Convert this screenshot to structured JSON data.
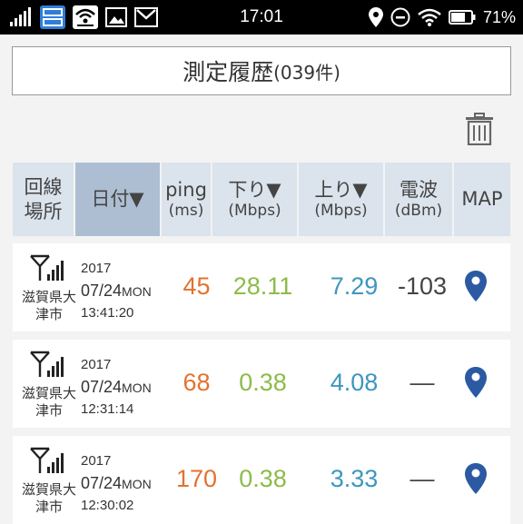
{
  "status_bar": {
    "time": "17:01",
    "battery": "71%",
    "left_icons": [
      "signal-icon",
      "app-icon",
      "wifi-icon",
      "image-icon",
      "gmail-icon"
    ],
    "right_icons": [
      "location-icon",
      "dnd-icon",
      "wifi-icon",
      "battery-icon"
    ]
  },
  "title": {
    "main": "測定履歴",
    "count": "(039件)"
  },
  "table": {
    "headers": [
      {
        "line1": "回線",
        "line2": "場所"
      },
      {
        "line1": "日付▼",
        "line2": ""
      },
      {
        "line1": "ping",
        "line2": "(ms)"
      },
      {
        "line1": "下り▼",
        "line2": "(Mbps)"
      },
      {
        "line1": "上り▼",
        "line2": "(Mbps)"
      },
      {
        "line1": "電波",
        "line2": "(dBm)"
      },
      {
        "line1": "MAP",
        "line2": ""
      }
    ],
    "rows": [
      {
        "area1": "滋賀県大",
        "area2": "津市",
        "year": "2017",
        "date": "07/24",
        "dow": "MON",
        "time": "13:41:20",
        "ping": "45",
        "down": "28.11",
        "up": "7.29",
        "signal": "-103"
      },
      {
        "area1": "滋賀県大",
        "area2": "津市",
        "year": "2017",
        "date": "07/24",
        "dow": "MON",
        "time": "12:31:14",
        "ping": "68",
        "down": "0.38",
        "up": "4.08",
        "signal": "—"
      },
      {
        "area1": "滋賀県大",
        "area2": "津市",
        "year": "2017",
        "date": "07/24",
        "dow": "MON",
        "time": "12:30:02",
        "ping": "170",
        "down": "0.38",
        "up": "3.33",
        "signal": "—"
      }
    ]
  },
  "colors": {
    "ping": "#e2722e",
    "down": "#8dbb4a",
    "up": "#3d96bf",
    "pin": "#2b5aa3",
    "header": "#dbe3ec",
    "header_selected": "#aebed2"
  }
}
